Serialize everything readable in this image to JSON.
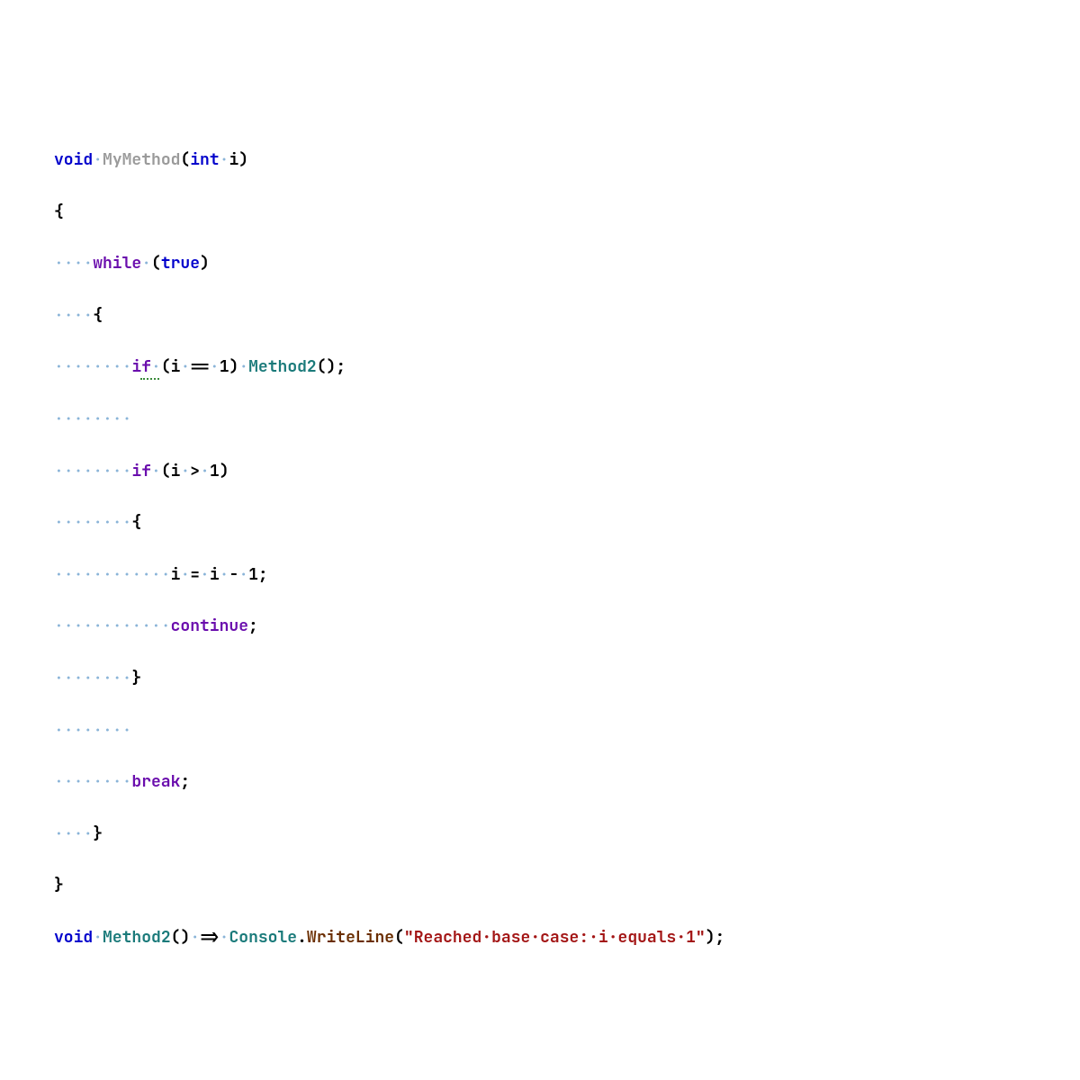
{
  "code": {
    "line1": {
      "void": "void",
      "sp": "·",
      "method": "MyMethod",
      "lp": "(",
      "int": "int",
      "sp2": "·",
      "param": "i",
      "rp": ")"
    },
    "line2": {
      "lb": "{"
    },
    "line3": {
      "ws": "····",
      "while": "while",
      "sp": "·",
      "lp": "(",
      "true": "true",
      "rp": ")"
    },
    "line4": {
      "ws": "····",
      "lb": "{"
    },
    "line5": {
      "ws": "········",
      "if": "if",
      "sp": "·",
      "lp": "(",
      "i": "i",
      "sp2": "·",
      "eq": "==",
      "sp3": "·",
      "one": "1",
      "rp": ")",
      "sp4": "·",
      "m2": "Method2",
      "lp2": "(",
      "rp2": ")",
      "semi": ";"
    },
    "line6": {
      "ws": "········"
    },
    "line7": {
      "ws": "········",
      "if": "if",
      "sp": "·",
      "lp": "(",
      "i": "i",
      "sp2": "·",
      "gt": ">",
      "sp3": "·",
      "one": "1",
      "rp": ")"
    },
    "line8": {
      "ws": "········",
      "lb": "{"
    },
    "line9": {
      "ws": "············",
      "i": "i",
      "sp": "·",
      "eq": "=",
      "sp2": "·",
      "i2": "i",
      "sp3": "·",
      "minus": "-",
      "sp4": "·",
      "one": "1",
      "semi": ";"
    },
    "line10": {
      "ws": "············",
      "cont": "continue",
      "semi": ";"
    },
    "line11": {
      "ws": "········",
      "rb": "}"
    },
    "line12": {
      "ws": "········"
    },
    "line13": {
      "ws": "········",
      "break": "break",
      "semi": ";"
    },
    "line14": {
      "ws": "····",
      "rb": "}"
    },
    "line15": {
      "rb": "}"
    },
    "line16": {
      "void": "void",
      "sp": "·",
      "m2": "Method2",
      "lp": "(",
      "rp": ")",
      "sp2": "·",
      "arrow": "=>",
      "sp3": "·",
      "console": "Console",
      "dot": ".",
      "wl": "WriteLine",
      "lp2": "(",
      "str": "\"Reached·base·case:·i·equals·1\"",
      "rp2": ")",
      "semi": ";"
    }
  }
}
